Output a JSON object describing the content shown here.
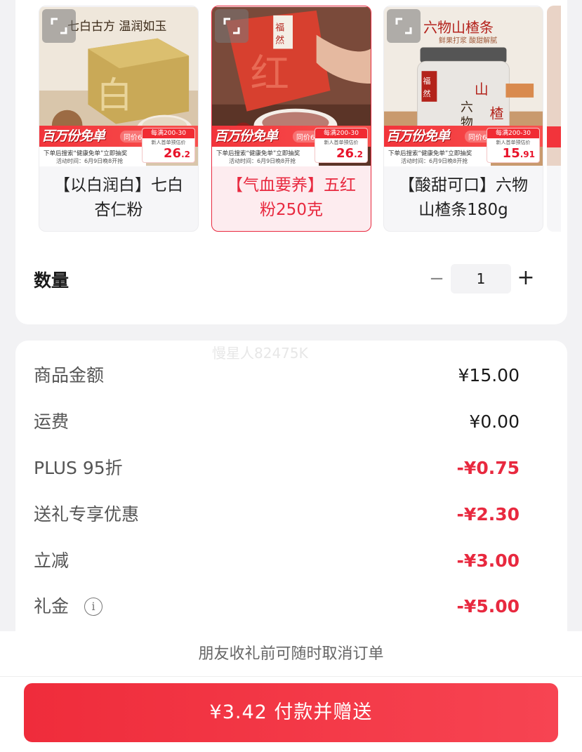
{
  "products": [
    {
      "caption": "七白古方 温润如玉",
      "promo_big": "百万份免单",
      "promo_tag": "同价618",
      "reward_top": "每满200-30",
      "reward_mid": "新人首单预估价",
      "reward_price_int": "26",
      "reward_price_dec": ".2",
      "note_line1": "下单后搜索“健康免单”立即抽奖",
      "note_line2": "活动时间：6月9日晚8开抢",
      "title": "【以白润白】七白杏仁粉",
      "selected": false
    },
    {
      "caption": "",
      "promo_big": "百万份免单",
      "promo_tag": "同价618",
      "reward_top": "每满200-30",
      "reward_mid": "新人首单预估价",
      "reward_price_int": "26",
      "reward_price_dec": ".2",
      "note_line1": "下单后搜索“健康免单”立即抽奖",
      "note_line2": "活动时间：6月9日晚8开抢",
      "title": "【气血要养】五红粉250克",
      "selected": true
    },
    {
      "caption": "六物山楂条",
      "caption_sub": "鲜果打浆 酸甜解腻",
      "promo_big": "百万份免单",
      "promo_tag": "同价618",
      "reward_top": "每满200-30",
      "reward_mid": "新人首单预估价",
      "reward_price_int": "15",
      "reward_price_dec": ".91",
      "note_line1": "下单后搜索“健康免单”立即抽奖",
      "note_line2": "活动时间：6月9日晚8开抢",
      "title": "【酸甜可口】六物山楂条180g",
      "selected": false
    }
  ],
  "quantity": {
    "label": "数量",
    "minus": "−",
    "value": "1",
    "plus": "+"
  },
  "watermark": "慢星人82475K",
  "price_rows": [
    {
      "label": "商品金额",
      "value": "¥15.00",
      "negative": false
    },
    {
      "label": "运费",
      "value": "¥0.00",
      "negative": false
    },
    {
      "label": "PLUS 95折",
      "value": "-¥0.75",
      "negative": true
    },
    {
      "label": "送礼专享优惠",
      "value": "-¥2.30",
      "negative": true
    },
    {
      "label": "立减",
      "value": "-¥3.00",
      "negative": true
    },
    {
      "label": "礼金",
      "value": "-¥5.00",
      "negative": true
    }
  ],
  "footer": {
    "notice": "朋友收礼前可随时取消订单",
    "pay_button": "¥3.42 付款并赠送"
  },
  "colors": {
    "accent": "#e8293f",
    "background": "#f2f2f4"
  }
}
